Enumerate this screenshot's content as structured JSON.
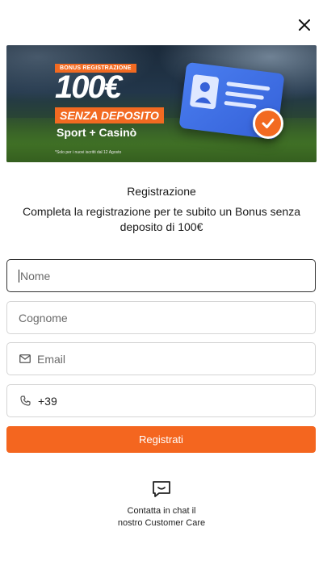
{
  "header": {
    "close_icon": "close-icon"
  },
  "banner": {
    "bonus_tag": "BONUS REGISTRAZIONE",
    "amount": "100€",
    "no_deposit": "SENZA DEPOSITO",
    "products": "Sport + Casinò",
    "note": "*Solo per i nuovi iscritti dal 12 Agosto",
    "accent_color": "#f26a21"
  },
  "form": {
    "title": "Registrazione",
    "subtitle": "Completa la registrazione per te subito un Bonus senza deposito di 100€",
    "first_name_placeholder": "Nome",
    "last_name_placeholder": "Cognome",
    "email_placeholder": "Email",
    "email_icon": "envelope-icon",
    "phone_prefix": "+39",
    "phone_icon": "phone-icon",
    "submit_label": "Registrati",
    "submit_color": "#f4661f"
  },
  "support": {
    "chat_icon": "chat-icon",
    "line1": "Contatta in chat il",
    "line2": "nostro Customer Care"
  }
}
